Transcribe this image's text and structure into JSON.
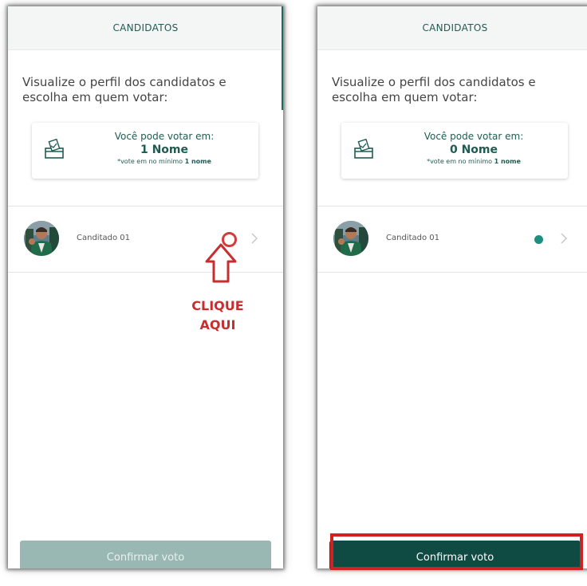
{
  "screens": [
    {
      "header_title": "CANDIDATOS",
      "intro_text": "Visualize o perfil dos candidatos e escolha em quem votar:",
      "vote_card": {
        "line1": "Você pode votar em:",
        "count": "1 Nome",
        "hint_prefix": "*vote em no mínimo ",
        "hint_bold": "1 nome"
      },
      "candidate": {
        "name": "Canditado 01",
        "selected": false
      },
      "annotation": {
        "line1": "CLIQUE",
        "line2": "AQUI"
      },
      "confirm_button": {
        "label": "Confirmar voto",
        "state": "disabled"
      }
    },
    {
      "header_title": "CANDIDATOS",
      "intro_text": "Visualize o perfil dos candidatos e escolha em quem votar:",
      "vote_card": {
        "line1": "Você pode votar em:",
        "count": "0 Nome",
        "hint_prefix": "*vote em no mínimo ",
        "hint_bold": "1 nome"
      },
      "candidate": {
        "name": "Canditado 01",
        "selected": true
      },
      "confirm_button": {
        "label": "Confirmar voto",
        "state": "enabled"
      }
    }
  ],
  "icons": {
    "ballot": "ballot-box-icon",
    "chevron": "chevron-right-icon",
    "arrow": "arrow-up-icon"
  },
  "colors": {
    "brand_dark": "#0f4a43",
    "brand_text": "#1f5b53",
    "selected_dot": "#1e8f7d",
    "disabled_button": "#9ab8b3",
    "annotation_red": "#c62f2f"
  }
}
